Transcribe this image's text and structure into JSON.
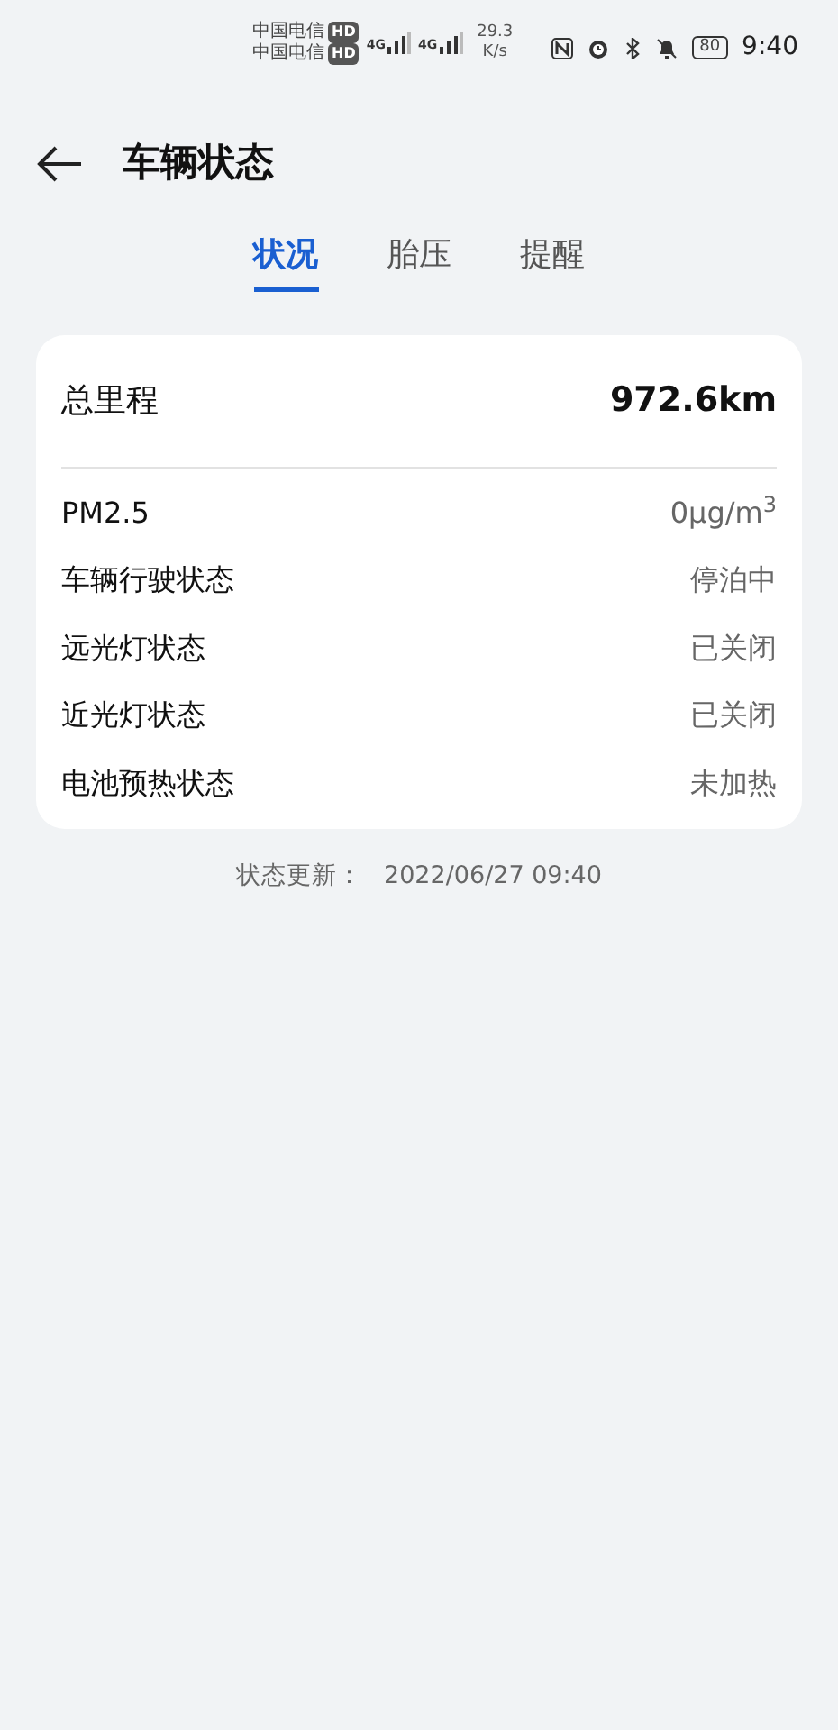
{
  "status_bar": {
    "carriers": [
      {
        "name": "中国电信",
        "badge": "HD",
        "network": "4G"
      },
      {
        "name": "中国电信",
        "badge": "HD",
        "network": "4G"
      }
    ],
    "speed": "29.3",
    "speed_unit": "K/s",
    "battery": "80",
    "time": "9:40"
  },
  "header": {
    "title": "车辆状态"
  },
  "tabs": [
    {
      "label": "状况",
      "selected": true
    },
    {
      "label": "胎压",
      "selected": false
    },
    {
      "label": "提醒",
      "selected": false
    }
  ],
  "summary": {
    "label": "总里程",
    "value": "972.6km"
  },
  "rows": [
    {
      "label": "PM2.5",
      "value": "0μg/m$^{3}$"
    },
    {
      "label": "车辆行驶状态",
      "value": "停泊中"
    },
    {
      "label": "远光灯状态",
      "value": "已关闭"
    },
    {
      "label": "近光灯状态",
      "value": "已关闭"
    },
    {
      "label": "电池预热状态",
      "value": "未加热"
    }
  ],
  "footer": {
    "label": "状态更新：",
    "time": "2022/06/27 09:40"
  }
}
